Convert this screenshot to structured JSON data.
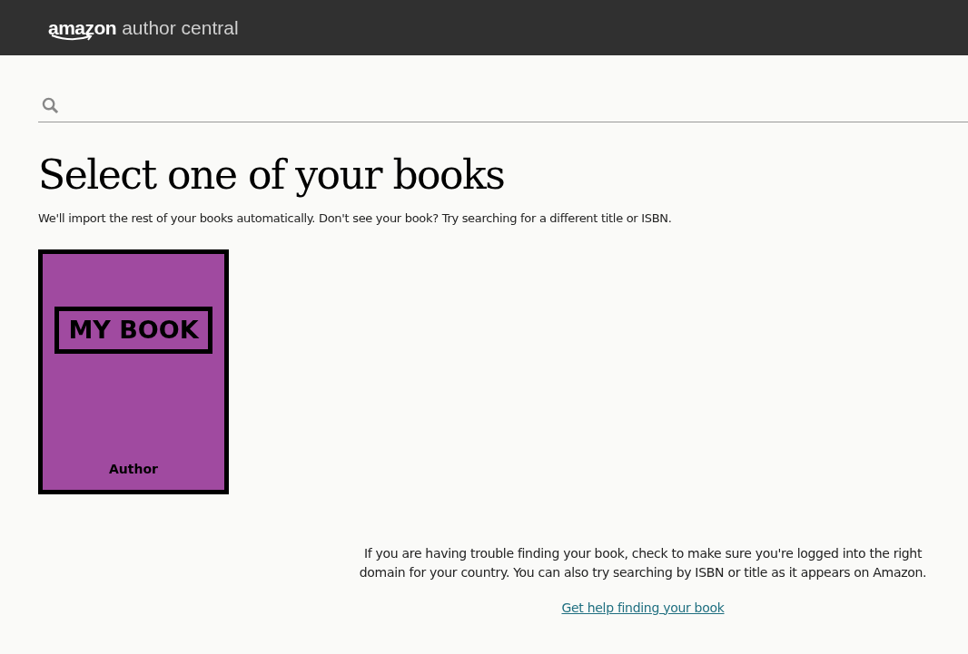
{
  "header": {
    "logo_brand": "amazon",
    "logo_product": "author central"
  },
  "title": "Select one of your books",
  "subtitle": "We'll import the rest of your books automatically. Don't see your book? Try searching for a different title or ISBN.",
  "books": [
    {
      "title": "MY BOOK",
      "author": "Author",
      "color": "#a04aa0"
    }
  ],
  "help": {
    "text": "If you are having trouble finding your book, check to make sure you're logged into the right domain for your country. You can also try searching by ISBN or title as it appears on Amazon.",
    "link": "Get help finding your book"
  }
}
